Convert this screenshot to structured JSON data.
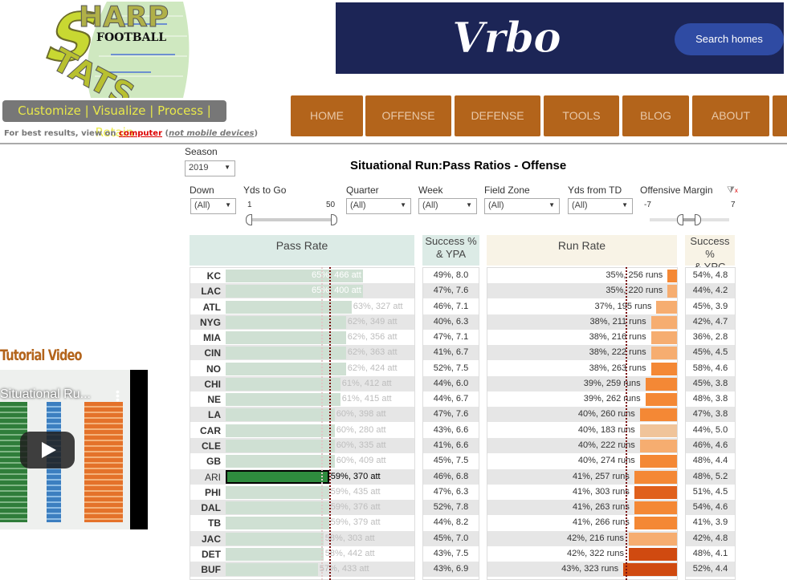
{
  "logo": {
    "text_sharp": "SHARP",
    "text_football": "FOOTBALL",
    "text_stats": "STATS"
  },
  "tagline": "Customize | Visualize | Process | Retain",
  "best_results": {
    "prefix": "For best results, view on ",
    "link": "computer",
    "open": " (",
    "italic": "not mobile devices",
    "close": ")"
  },
  "ad": {
    "brand": "Vrbo",
    "button": "Search homes",
    "bg": "#1c2556"
  },
  "nav": [
    "HOME",
    "OFFENSE",
    "DEFENSE",
    "TOOLS",
    "BLOG",
    "ABOUT"
  ],
  "nav_color": "#b3641b",
  "video": {
    "heading": "Tutorial Video",
    "title": "Situational Ru...",
    "play_icon": "play-icon"
  },
  "season": {
    "label": "Season",
    "value": "2019"
  },
  "title": "Situational Run:Pass Ratios - Offense",
  "filters": {
    "down": {
      "label": "Down",
      "value": "(All)"
    },
    "yds_to_go": {
      "label": "Yds to Go",
      "min": "1",
      "max": "50"
    },
    "quarter": {
      "label": "Quarter",
      "value": "(All)"
    },
    "week": {
      "label": "Week",
      "value": "(All)"
    },
    "field_zone": {
      "label": "Field Zone",
      "value": "(All)"
    },
    "yds_from_td": {
      "label": "Yds from TD",
      "value": "(All)"
    },
    "offensive_margin": {
      "label": "Offensive Margin",
      "min": "-7",
      "max": "7"
    }
  },
  "headers": {
    "pass_rate": "Pass Rate",
    "success_ypa": [
      "Success %",
      "& YPA"
    ],
    "run_rate": "Run Rate",
    "success_ypc": [
      "Success %",
      "& YPC"
    ]
  },
  "highlight_team": "ARI",
  "rows": [
    {
      "team": "KC",
      "pass": "65%, 466 att",
      "pass_pct": 65,
      "ypa": "49%, 8.0",
      "run": "35%, 256 runs",
      "run_pct": 35,
      "runs": 256,
      "ypc": "54%, 4.8"
    },
    {
      "team": "LAC",
      "pass": "65%, 400 att",
      "pass_pct": 65,
      "ypa": "47%, 7.6",
      "run": "35%, 220 runs",
      "run_pct": 35,
      "runs": 220,
      "ypc": "44%, 4.2"
    },
    {
      "team": "ATL",
      "pass": "63%, 327 att",
      "pass_pct": 63,
      "ypa": "46%, 7.1",
      "run": "37%, 195 runs",
      "run_pct": 37,
      "runs": 195,
      "ypc": "45%, 3.9"
    },
    {
      "team": "NYG",
      "pass": "62%, 349 att",
      "pass_pct": 62,
      "ypa": "40%, 6.3",
      "run": "38%, 211 runs",
      "run_pct": 38,
      "runs": 211,
      "ypc": "42%, 4.7"
    },
    {
      "team": "MIA",
      "pass": "62%, 356 att",
      "pass_pct": 62,
      "ypa": "47%, 7.1",
      "run": "38%, 216 runs",
      "run_pct": 38,
      "runs": 216,
      "ypc": "36%, 2.8"
    },
    {
      "team": "CIN",
      "pass": "62%, 363 att",
      "pass_pct": 62,
      "ypa": "41%, 6.7",
      "run": "38%, 222 runs",
      "run_pct": 38,
      "runs": 222,
      "ypc": "45%, 4.5"
    },
    {
      "team": "NO",
      "pass": "62%, 424 att",
      "pass_pct": 62,
      "ypa": "52%, 7.5",
      "run": "38%, 263 runs",
      "run_pct": 38,
      "runs": 263,
      "ypc": "58%, 4.6"
    },
    {
      "team": "CHI",
      "pass": "61%, 412 att",
      "pass_pct": 61,
      "ypa": "44%, 6.0",
      "run": "39%, 259 runs",
      "run_pct": 39,
      "runs": 259,
      "ypc": "45%, 3.8"
    },
    {
      "team": "NE",
      "pass": "61%, 415 att",
      "pass_pct": 61,
      "ypa": "44%, 6.7",
      "run": "39%, 262 runs",
      "run_pct": 39,
      "runs": 262,
      "ypc": "48%, 3.8"
    },
    {
      "team": "LA",
      "pass": "60%, 398 att",
      "pass_pct": 60,
      "ypa": "47%, 7.6",
      "run": "40%, 260 runs",
      "run_pct": 40,
      "runs": 260,
      "ypc": "47%, 3.8"
    },
    {
      "team": "CAR",
      "pass": "60%, 280 att",
      "pass_pct": 60,
      "ypa": "43%, 6.6",
      "run": "40%, 183 runs",
      "run_pct": 40,
      "runs": 183,
      "ypc": "44%, 5.0"
    },
    {
      "team": "CLE",
      "pass": "60%, 335 att",
      "pass_pct": 60,
      "ypa": "41%, 6.6",
      "run": "40%, 222 runs",
      "run_pct": 40,
      "runs": 222,
      "ypc": "46%, 4.6"
    },
    {
      "team": "GB",
      "pass": "60%, 409 att",
      "pass_pct": 60,
      "ypa": "45%, 7.5",
      "run": "40%, 274 runs",
      "run_pct": 40,
      "runs": 274,
      "ypc": "48%, 4.4"
    },
    {
      "team": "ARI",
      "pass": "59%, 370 att",
      "pass_pct": 59,
      "ypa": "46%, 6.8",
      "run": "41%, 257 runs",
      "run_pct": 41,
      "runs": 257,
      "ypc": "48%, 5.2"
    },
    {
      "team": "PHI",
      "pass": "59%, 435 att",
      "pass_pct": 59,
      "ypa": "47%, 6.3",
      "run": "41%, 303 runs",
      "run_pct": 41,
      "runs": 303,
      "ypc": "51%, 4.5"
    },
    {
      "team": "DAL",
      "pass": "59%, 376 att",
      "pass_pct": 59,
      "ypa": "52%, 7.8",
      "run": "41%, 263 runs",
      "run_pct": 41,
      "runs": 263,
      "ypc": "54%, 4.6"
    },
    {
      "team": "TB",
      "pass": "59%, 379 att",
      "pass_pct": 59,
      "ypa": "44%, 8.2",
      "run": "41%, 266 runs",
      "run_pct": 41,
      "runs": 266,
      "ypc": "41%, 3.9"
    },
    {
      "team": "JAC",
      "pass": "58%, 303 att",
      "pass_pct": 58,
      "ypa": "45%, 7.0",
      "run": "42%, 216 runs",
      "run_pct": 42,
      "runs": 216,
      "ypc": "42%, 4.8"
    },
    {
      "team": "DET",
      "pass": "58%, 442 att",
      "pass_pct": 58,
      "ypa": "43%, 7.5",
      "run": "42%, 322 runs",
      "run_pct": 42,
      "runs": 322,
      "ypc": "48%, 4.1"
    },
    {
      "team": "BUF",
      "pass": "57%, 433 att",
      "pass_pct": 57,
      "ypa": "43%, 6.9",
      "run": "43%, 323 runs",
      "run_pct": 43,
      "runs": 323,
      "ypc": "52%, 4.4"
    }
  ],
  "colors": {
    "pass_bar": "#cfe0d3",
    "pass_highlight": "#2e8b3e",
    "pass_header_bg": "#dcebe6",
    "run_header_bg": "#f8f3e6",
    "average_line": "#7a1010"
  }
}
